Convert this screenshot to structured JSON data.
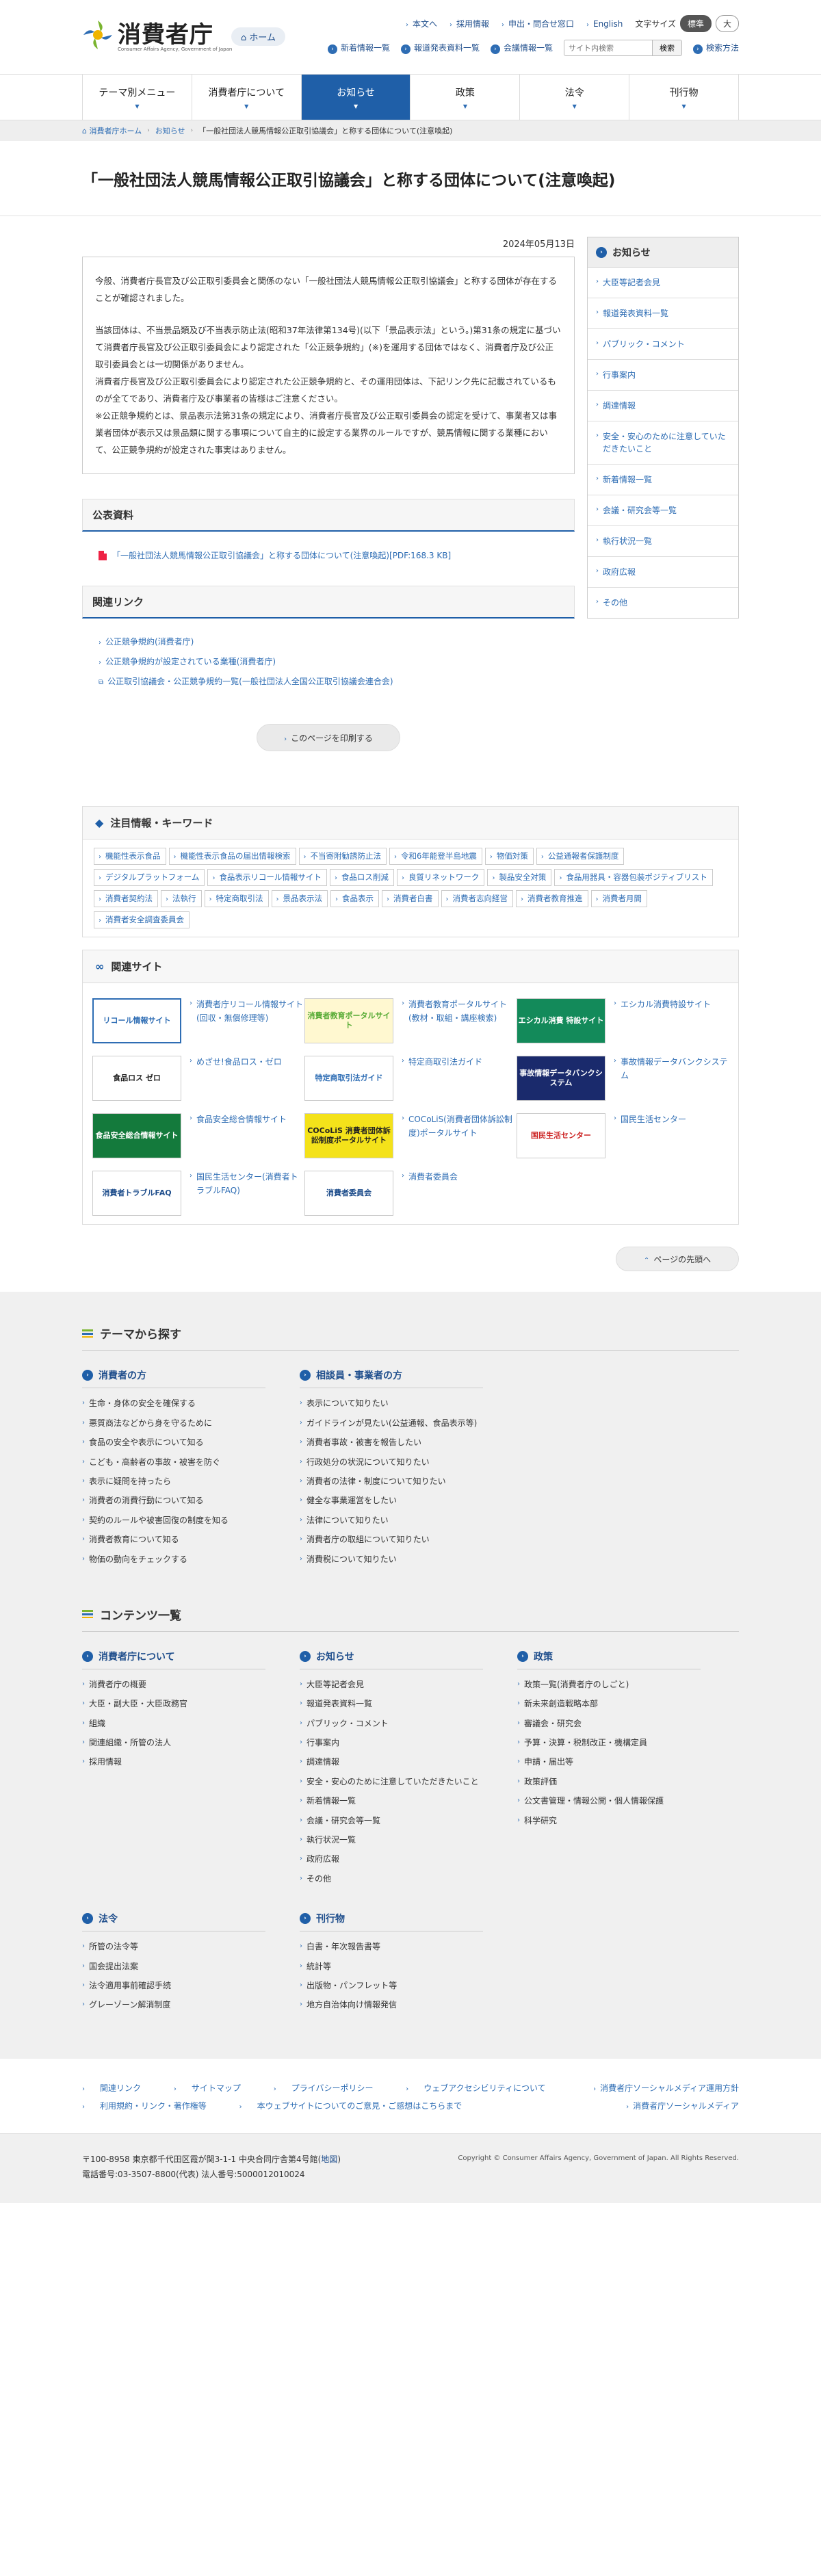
{
  "header": {
    "logo_text": "消費者庁",
    "logo_sub": "Consumer Affairs Agency, Government of Japan",
    "home": "ホーム",
    "util_links": [
      "本文へ",
      "採用情報",
      "申出・問合せ窓口",
      "English"
    ],
    "font_size_label": "文字サイズ",
    "font_sizes": [
      "標準",
      "大"
    ],
    "sub_links": [
      "新着情報一覧",
      "報道発表資料一覧",
      "会議情報一覧"
    ],
    "search_placeholder": "サイト内検索",
    "search_button": "検索",
    "search_help": "検索方法"
  },
  "gnav": [
    "テーマ別メニュー",
    "消費者庁について",
    "お知らせ",
    "政策",
    "法令",
    "刊行物"
  ],
  "breadcrumb": [
    "消費者庁ホーム",
    "お知らせ",
    "「一般社団法人競馬情報公正取引協議会」と称する団体について(注意喚起)"
  ],
  "page": {
    "title": "「一般社団法人競馬情報公正取引協議会」と称する団体について(注意喚起)",
    "date": "2024年05月13日",
    "paragraphs": [
      "今般、消費者庁長官及び公正取引委員会と関係のない「一般社団法人競馬情報公正取引協議会」と称する団体が存在することが確認されました。",
      "当該団体は、不当景品類及び不当表示防止法(昭和37年法律第134号)(以下「景品表示法」という。)第31条の規定に基づいて消費者庁長官及び公正取引委員会により認定された「公正競争規約」(※)を運用する団体ではなく、消費者庁及び公正取引委員会とは一切関係がありません。",
      "消費者庁長官及び公正取引委員会により認定された公正競争規約と、その運用団体は、下記リンク先に記載されているものが全てであり、消費者庁及び事業者の皆様はご注意ください。",
      "※公正競争規約とは、景品表示法第31条の規定により、消費者庁長官及び公正取引委員会の認定を受けて、事業者又は事業者団体が表示又は景品類に関する事項について自主的に設定する業界のルールですが、競馬情報に関する業種において、公正競争規約が設定された事実はありません。"
    ],
    "documents_heading": "公表資料",
    "document_link": "「一般社団法人競馬情報公正取引協議会」と称する団体について(注意喚起)[PDF:168.3 KB]",
    "links_heading": "関連リンク",
    "related_links": [
      "公正競争規約(消費者庁)",
      "公正競争規約が設定されている業種(消費者庁)",
      "公正取引協議会・公正競争規約一覧(一般社団法人全国公正取引協議会連合会)"
    ],
    "print_button": "このページを印刷する"
  },
  "sidebar": {
    "heading": "お知らせ",
    "items": [
      "大臣等記者会見",
      "報道発表資料一覧",
      "パブリック・コメント",
      "行事案内",
      "調達情報",
      "安全・安心のために注意していただきたいこと",
      "新着情報一覧",
      "会議・研究会等一覧",
      "執行状況一覧",
      "政府広報",
      "その他"
    ]
  },
  "keywords": {
    "heading": "注目情報・キーワード",
    "tags": [
      "機能性表示食品",
      "機能性表示食品の届出情報検索",
      "不当寄附勧誘防止法",
      "令和6年能登半島地震",
      "物価対策",
      "公益通報者保護制度",
      "デジタルプラットフォーム",
      "食品表示リコール情報サイト",
      "食品ロス削減",
      "良質リネットワーク",
      "製品安全対策",
      "食品用器具・容器包装ポジティブリスト",
      "消費者契約法",
      "法執行",
      "特定商取引法",
      "景品表示法",
      "食品表示",
      "消費者白書",
      "消費者志向経営",
      "消費者教育推進",
      "消費者月間",
      "消費者安全調査委員会"
    ]
  },
  "related_sites": {
    "heading": "関連サイト",
    "items": [
      {
        "banner": "リコール情報サイト",
        "label": "消費者庁リコール情報サイト(回収・無償修理等)"
      },
      {
        "banner": "消費者教育ポータルサイト",
        "label": "消費者教育ポータルサイト(教材・取組・講座検索)"
      },
      {
        "banner": "エシカル消費 特設サイト",
        "label": "エシカル消費特設サイト"
      },
      {
        "banner": "食品ロス ゼロ",
        "label": "めざせ!食品ロス・ゼロ"
      },
      {
        "banner": "特定商取引法ガイド",
        "label": "特定商取引法ガイド"
      },
      {
        "banner": "事故情報データバンクシステム",
        "label": "事故情報データバンクシステム"
      },
      {
        "banner": "食品安全総合情報サイト",
        "label": "食品安全総合情報サイト"
      },
      {
        "banner": "COCoLiS 消費者団体訴訟制度ポータルサイト",
        "label": "COCoLiS(消費者団体訴訟制度)ポータルサイト"
      },
      {
        "banner": "国民生活センター",
        "label": "国民生活センター"
      },
      {
        "banner": "消費者トラブルFAQ",
        "label": "国民生活センター(消費者トラブルFAQ)"
      },
      {
        "banner": "消費者委員会",
        "label": "消費者委員会"
      }
    ]
  },
  "pagetop": "ページの先頭へ",
  "theme_section": {
    "heading": "テーマから探す",
    "cols": [
      {
        "title": "消費者の方",
        "items": [
          "生命・身体の安全を確保する",
          "悪質商法などから身を守るために",
          "食品の安全や表示について知る",
          "こども・高齢者の事故・被害を防ぐ",
          "表示に疑問を持ったら",
          "消費者の消費行動について知る",
          "契約のルールや被害回復の制度を知る",
          "消費者教育について知る",
          "物価の動向をチェックする"
        ]
      },
      {
        "title": "相談員・事業者の方",
        "items": [
          "表示について知りたい",
          "ガイドラインが見たい(公益通報、食品表示等)",
          "消費者事故・被害を報告したい",
          "行政処分の状況について知りたい",
          "消費者の法律・制度について知りたい",
          "健全な事業運営をしたい",
          "法律について知りたい",
          "消費者庁の取組について知りたい",
          "消費税について知りたい"
        ]
      }
    ]
  },
  "contents_section": {
    "heading": "コンテンツ一覧",
    "cols": [
      {
        "title": "消費者庁について",
        "items": [
          "消費者庁の概要",
          "大臣・副大臣・大臣政務官",
          "組織",
          "関連組織・所管の法人",
          "採用情報"
        ]
      },
      {
        "title": "お知らせ",
        "items": [
          "大臣等記者会見",
          "報道発表資料一覧",
          "パブリック・コメント",
          "行事案内",
          "調達情報",
          "安全・安心のために注意していただきたいこと",
          "新着情報一覧",
          "会議・研究会等一覧",
          "執行状況一覧",
          "政府広報",
          "その他"
        ]
      },
      {
        "title": "政策",
        "items": [
          "政策一覧(消費者庁のしごと)",
          "新未来創造戦略本部",
          "審議会・研究会",
          "予算・決算・税制改正・機構定員",
          "申請・届出等",
          "政策評価",
          "公文書管理・情報公開・個人情報保護",
          "科学研究"
        ]
      }
    ],
    "cols2": [
      {
        "title": "法令",
        "items": [
          "所管の法令等",
          "国会提出法案",
          "法令適用事前確認手続",
          "グレーゾーン解消制度"
        ]
      },
      {
        "title": "刊行物",
        "items": [
          "白書・年次報告書等",
          "統計等",
          "出版物・パンフレット等",
          "地方自治体向け情報発信"
        ]
      }
    ]
  },
  "footer": {
    "links_row1": [
      "関連リンク",
      "サイトマップ",
      "プライバシーポリシー",
      "ウェブアクセシビリティについて"
    ],
    "links_row2": [
      "利用規約・リンク・著作権等",
      "本ウェブサイトについてのご意見・ご感想はこちらまで"
    ],
    "social": [
      "消費者庁ソーシャルメディア運用方針",
      "消費者庁ソーシャルメディア"
    ],
    "address": "〒100-8958 東京都千代田区霞が関3-1-1 中央合同庁舎第4号館(",
    "map": "地図",
    "address_end": ")",
    "phone": "電話番号:03-3507-8800(代表)  法人番号:5000012010024",
    "copyright": "Copyright © Consumer Affairs Agency, Government of Japan. All Rights Reserved."
  },
  "colors": {
    "accent": "#1f5fa8",
    "link": "#2e6db4"
  }
}
